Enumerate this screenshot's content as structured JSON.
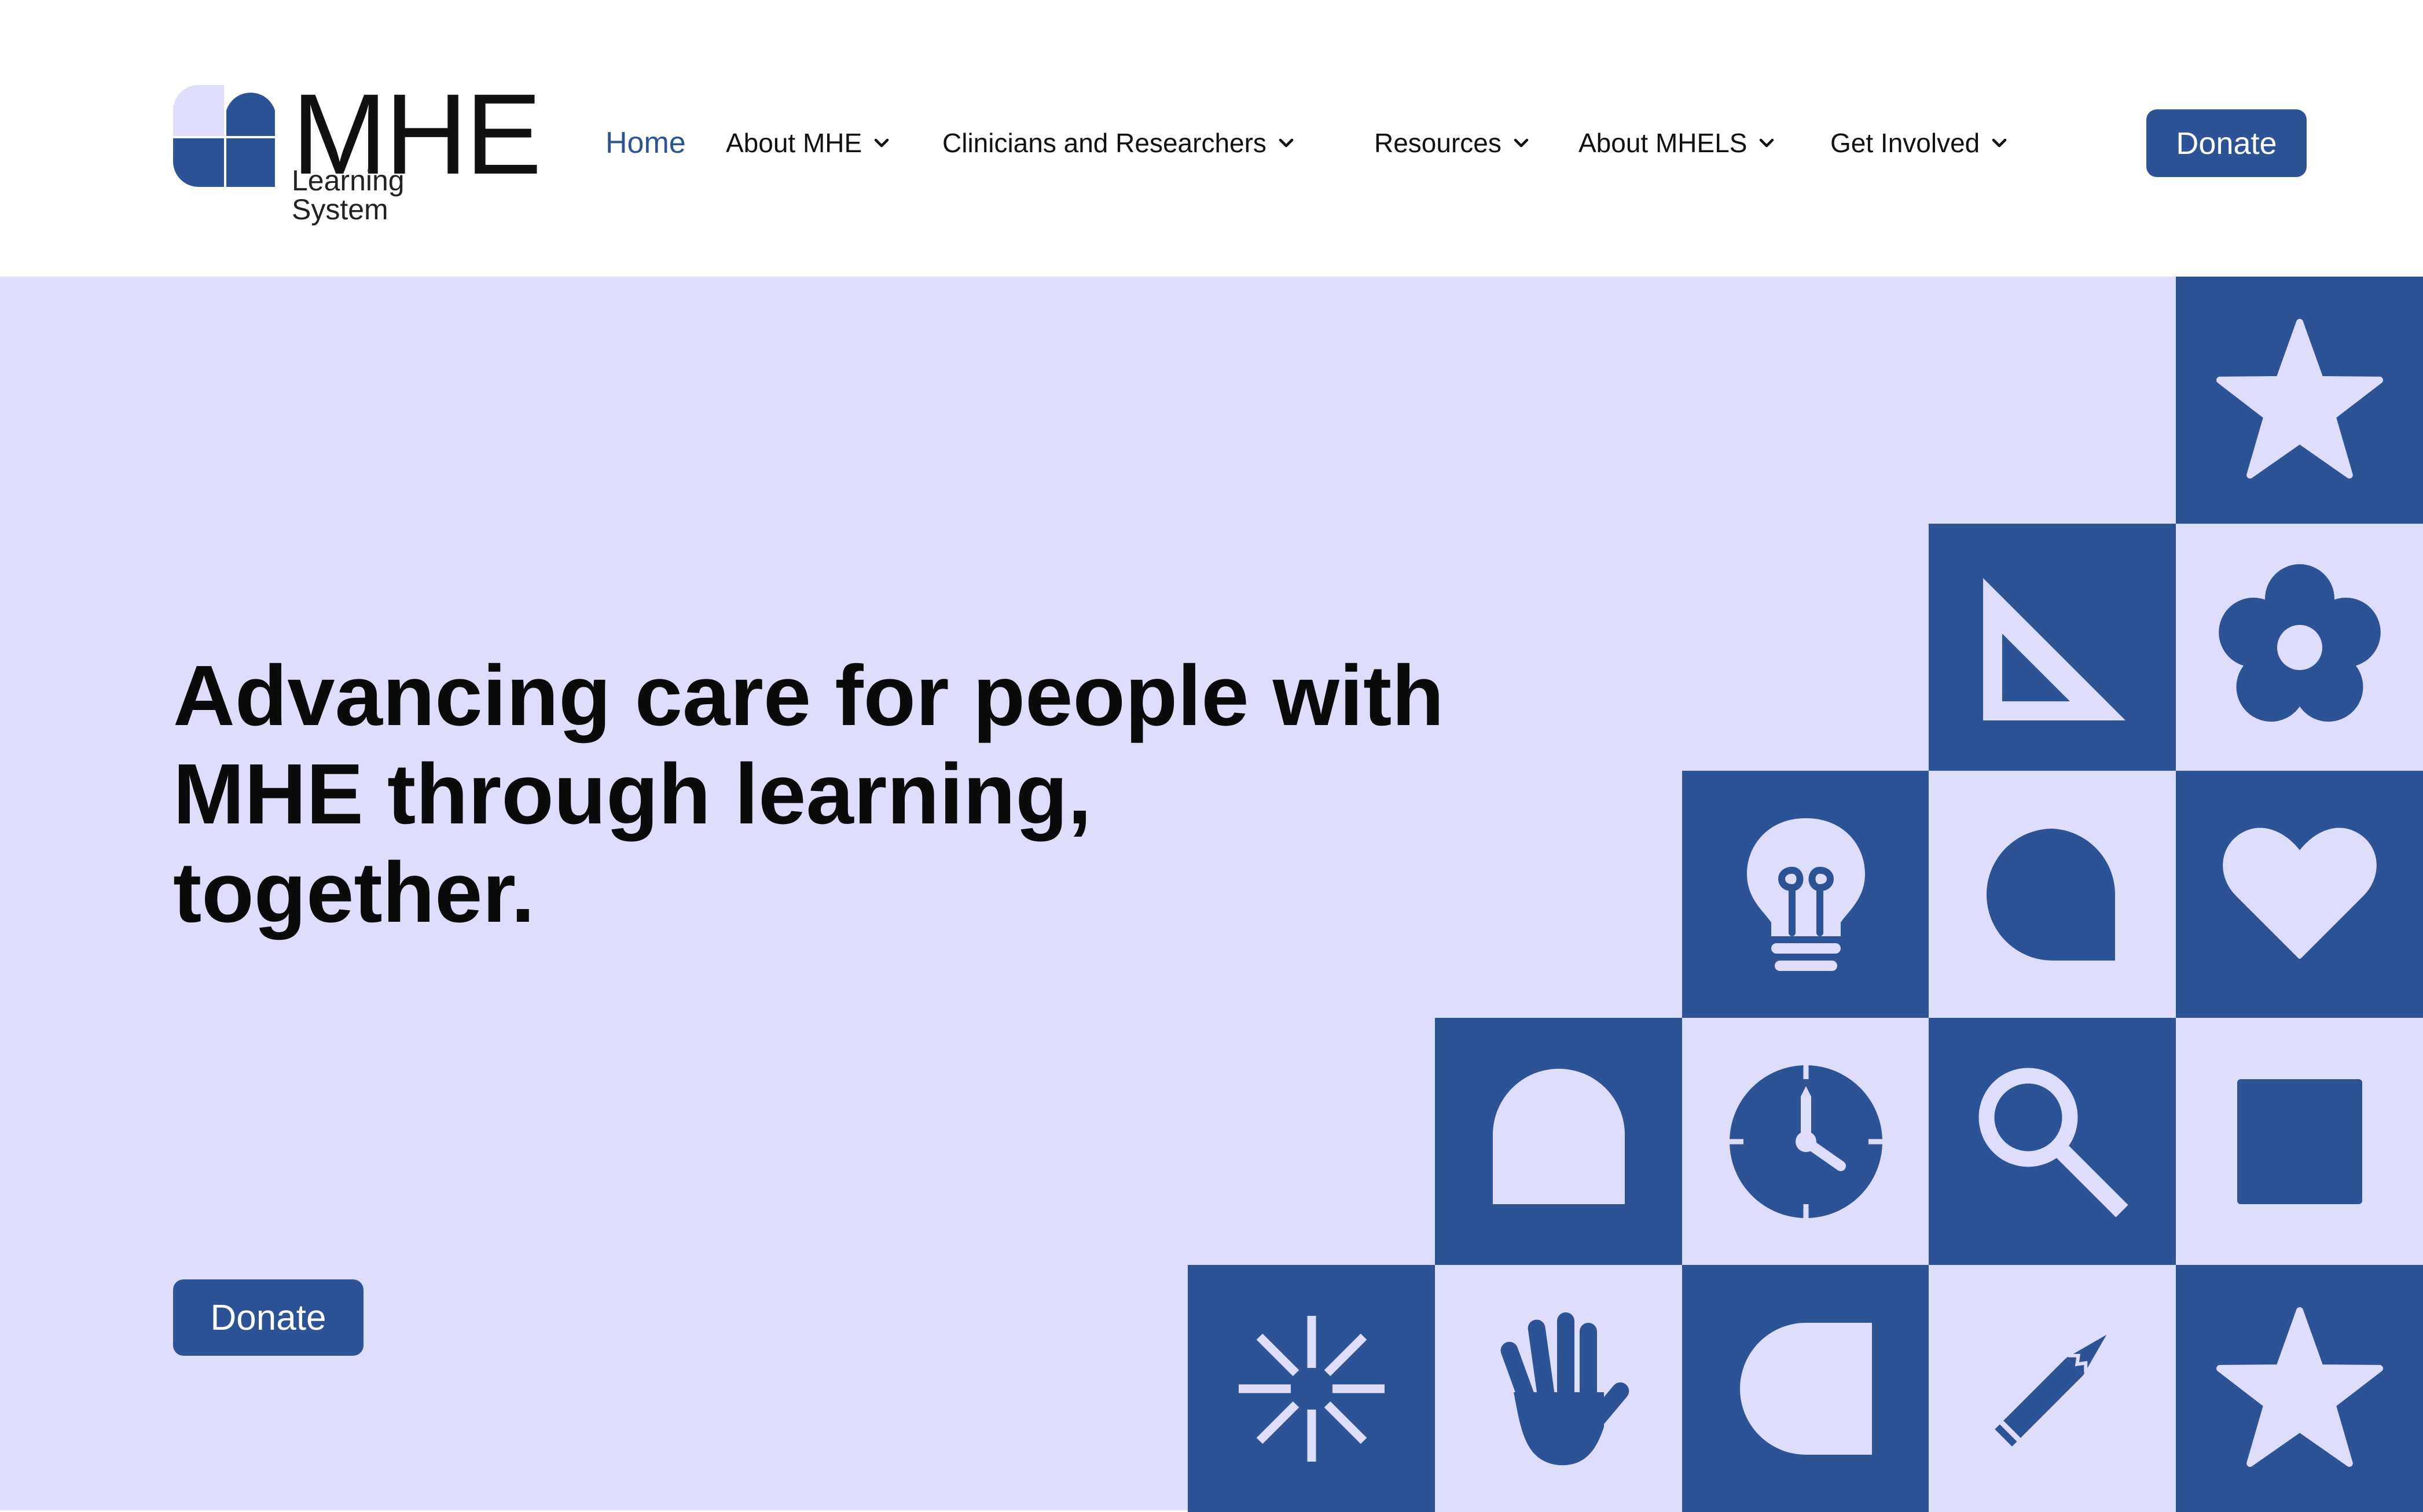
{
  "brand": {
    "wordmark": "MHE",
    "subtitle": "Learning System",
    "logo_colors": {
      "light": "#dfddfc",
      "dark": "#2d5397"
    }
  },
  "nav": {
    "items": [
      {
        "label": "Home",
        "active": true,
        "has_dropdown": false
      },
      {
        "label": "About MHE",
        "active": false,
        "has_dropdown": true
      },
      {
        "label": "Clinicians and Researchers",
        "active": false,
        "has_dropdown": true
      },
      {
        "label": "Resources",
        "active": false,
        "has_dropdown": true
      },
      {
        "label": "About MHELS",
        "active": false,
        "has_dropdown": true
      },
      {
        "label": "Get Involved",
        "active": false,
        "has_dropdown": true
      }
    ],
    "donate_label": "Donate"
  },
  "hero": {
    "headline_lines": [
      "Advancing care for people with",
      "MHE through learning,",
      "together."
    ],
    "donate_label": "Donate"
  },
  "mosaic_icons": [
    "star-icon",
    "triangle-ruler-icon",
    "flower-icon",
    "lightbulb-icon",
    "speech-bubble-icon",
    "heart-icon",
    "arch-icon",
    "clock-icon",
    "magnifier-icon",
    "square-icon",
    "asterisk-icon",
    "hand-icon",
    "d-shape-icon",
    "pencil-icon",
    "star-icon"
  ],
  "colors": {
    "accent": "#2d5397",
    "hero_bg": "#dfddfc",
    "header_bg": "#ffffff",
    "text": "#0b0b0b"
  }
}
